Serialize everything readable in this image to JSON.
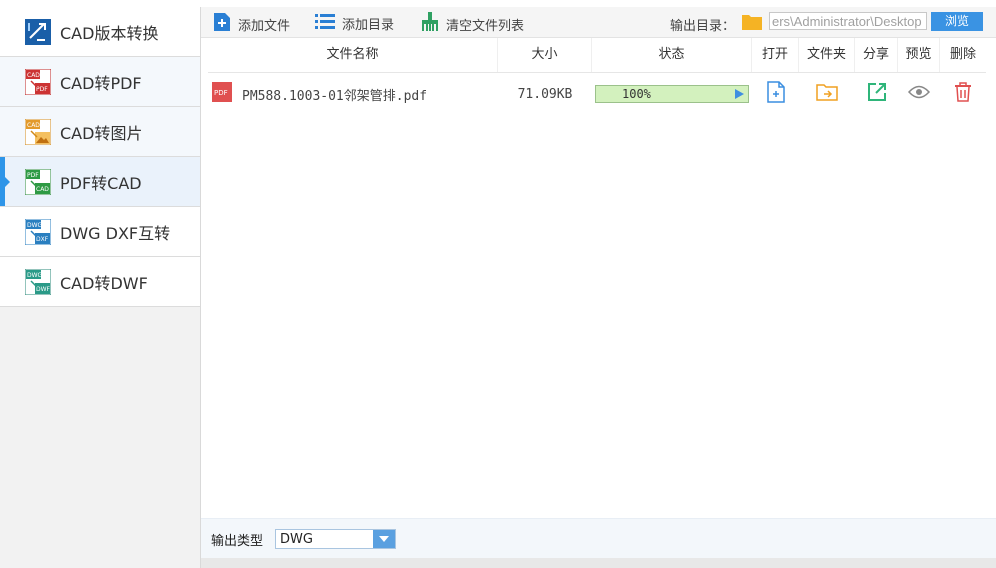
{
  "sidebar": {
    "items": [
      {
        "label": "CAD版本转换"
      },
      {
        "label": "CAD转PDF"
      },
      {
        "label": "CAD转图片"
      },
      {
        "label": "PDF转CAD"
      },
      {
        "label": "DWG DXF互转"
      },
      {
        "label": "CAD转DWF"
      }
    ]
  },
  "toolbar": {
    "add_file": "添加文件",
    "add_dir": "添加目录",
    "clear_list": "清空文件列表",
    "output_dir_label": "输出目录：",
    "output_dir_value": "ers\\Administrator\\Desktop",
    "browse": "浏览"
  },
  "table": {
    "headers": {
      "name": "文件名称",
      "size": "大小",
      "status": "状态",
      "open": "打开",
      "folder": "文件夹",
      "share": "分享",
      "preview": "预览",
      "delete": "删除"
    },
    "rows": [
      {
        "file_type_badge": "PDF",
        "name": "PM588.1003-01邻架管排.pdf",
        "size": "71.09KB",
        "progress_text": "100%",
        "progress": 1.0
      }
    ]
  },
  "bottom": {
    "output_type_label": "输出类型",
    "output_type_value": "DWG"
  },
  "colors": {
    "accent": "#2e95e8",
    "progress_fill": "#d3f1be",
    "delete_red": "#e05050",
    "folder_orange": "#f0a020",
    "share_green": "#2fb57a"
  }
}
